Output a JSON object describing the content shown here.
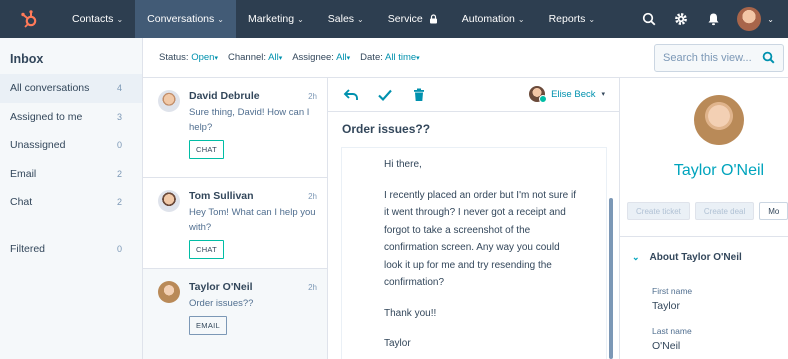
{
  "nav": {
    "items": [
      {
        "label": "Contacts",
        "active": false
      },
      {
        "label": "Conversations",
        "active": true
      },
      {
        "label": "Marketing",
        "active": false
      },
      {
        "label": "Sales",
        "active": false
      },
      {
        "label": "Service",
        "active": false
      },
      {
        "label": "Automation",
        "active": false
      },
      {
        "label": "Reports",
        "active": false
      }
    ],
    "icons": [
      "hubspot-logo",
      "search-icon",
      "gear-icon",
      "bell-icon",
      "user-avatar"
    ],
    "colors": {
      "bg": "#2d3e50",
      "active": "#425b76",
      "logo": "#ff7a59"
    }
  },
  "sidebar": {
    "title": "Inbox",
    "items": [
      {
        "label": "All conversations",
        "count": "4"
      },
      {
        "label": "Assigned to me",
        "count": "3"
      },
      {
        "label": "Unassigned",
        "count": "0"
      },
      {
        "label": "Email",
        "count": "2"
      },
      {
        "label": "Chat",
        "count": "2"
      },
      {
        "label": "Filtered",
        "count": "0"
      }
    ]
  },
  "filters": {
    "status_label": "Status:",
    "status_value": "Open",
    "channel_label": "Channel:",
    "channel_value": "All",
    "assignee_label": "Assignee:",
    "assignee_value": "All",
    "date_label": "Date:",
    "date_value": "All time",
    "search_placeholder": "Search this view..."
  },
  "conversations": [
    {
      "name": "David Debrule",
      "time": "2h",
      "preview": "Sure thing, David! How can I help?",
      "tag": "CHAT"
    },
    {
      "name": "Tom Sullivan",
      "time": "2h",
      "preview": "Hey Tom! What can I help you with?",
      "tag": "CHAT"
    },
    {
      "name": "Taylor O'Neil",
      "time": "2h",
      "preview": "Order issues??",
      "tag": "EMAIL"
    }
  ],
  "thread": {
    "assignee": "Elise Beck",
    "subject": "Order issues??",
    "greeting": "Hi there,",
    "body": "I recently placed an order but I'm not sure if it went through? I never got a receipt and forgot to take a screenshot of the confirmation screen. Any way you could look it up for me and try resending the confirmation?",
    "thanks": "Thank you!!",
    "signoff": "Taylor"
  },
  "contact": {
    "name": "Taylor O'Neil",
    "actions": [
      "Create ticket",
      "Create deal",
      "Mo"
    ],
    "about_title": "About Taylor O'Neil",
    "first_name_label": "First name",
    "first_name": "Taylor",
    "last_name_label": "Last name",
    "last_name": "O'Neil"
  }
}
